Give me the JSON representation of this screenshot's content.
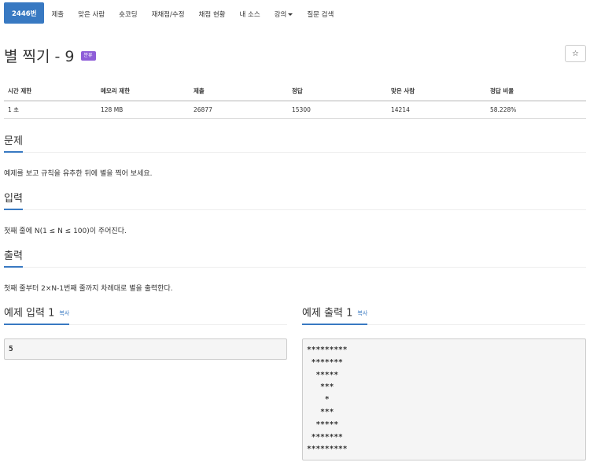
{
  "nav": {
    "items": [
      {
        "label": "2446번",
        "active": true
      },
      {
        "label": "제출"
      },
      {
        "label": "맞은 사람"
      },
      {
        "label": "숏코딩"
      },
      {
        "label": "재채점/수정"
      },
      {
        "label": "채점 현황"
      },
      {
        "label": "내 소스"
      },
      {
        "label": "강의"
      },
      {
        "label": "질문 검색"
      }
    ]
  },
  "problem": {
    "title": "별 찍기 - 9",
    "badge": "분류",
    "star_icon": "☆"
  },
  "stats": {
    "headers": [
      "시간 제한",
      "메모리 제한",
      "제출",
      "정답",
      "맞은 사람",
      "정답 비율"
    ],
    "values": [
      "1 초",
      "128 MB",
      "26877",
      "15300",
      "14214",
      "58.228%"
    ]
  },
  "sections": {
    "problem_heading": "문제",
    "problem_text": "예제를 보고 규칙을 유추한 뒤에 별을 찍어 보세요.",
    "input_heading": "입력",
    "input_text": "첫째 줄에 N(1 ≤ N ≤ 100)이 주어진다.",
    "output_heading": "출력",
    "output_text": "첫째 줄부터 2×N-1번째 줄까지 차례대로 별을 출력한다."
  },
  "samples": {
    "input_heading": "예제 입력 1",
    "output_heading": "예제 출력 1",
    "copy_label": "복사",
    "input_value": "5",
    "output_value": "*********\n *******\n  *****\n   ***\n    *\n   ***\n  *****\n *******\n*********"
  },
  "colors": {
    "primary": "#3879c2",
    "badge": "#8e5ed8"
  }
}
